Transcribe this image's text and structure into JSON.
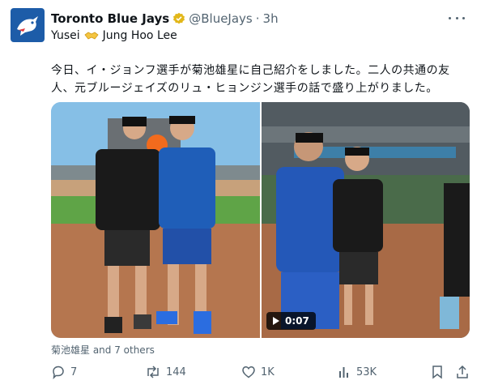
{
  "account": {
    "name": "Toronto Blue Jays",
    "handle": "@BlueJays",
    "separator": "·",
    "time": "3h",
    "brand_color": "#1d5ca8",
    "verified_color": "#e2b719"
  },
  "subline": {
    "left_name": "Yusei",
    "icon": "handshake-icon",
    "right_name": "Jung Hoo Lee"
  },
  "body": {
    "line1": "今日、イ・ジョンフ選手が菊池雄星に自己紹介をしました。二人の共通の友",
    "line2": "人、元ブルージェイズのリュ・ヒョンジン選手の話で盛り上がりました。"
  },
  "media": {
    "video_duration": "0:07"
  },
  "liked_by": "菊池雄星 and 7 others",
  "actions": {
    "reply_count": "7",
    "repost_count": "144",
    "like_count": "1K",
    "view_count": "53K"
  }
}
